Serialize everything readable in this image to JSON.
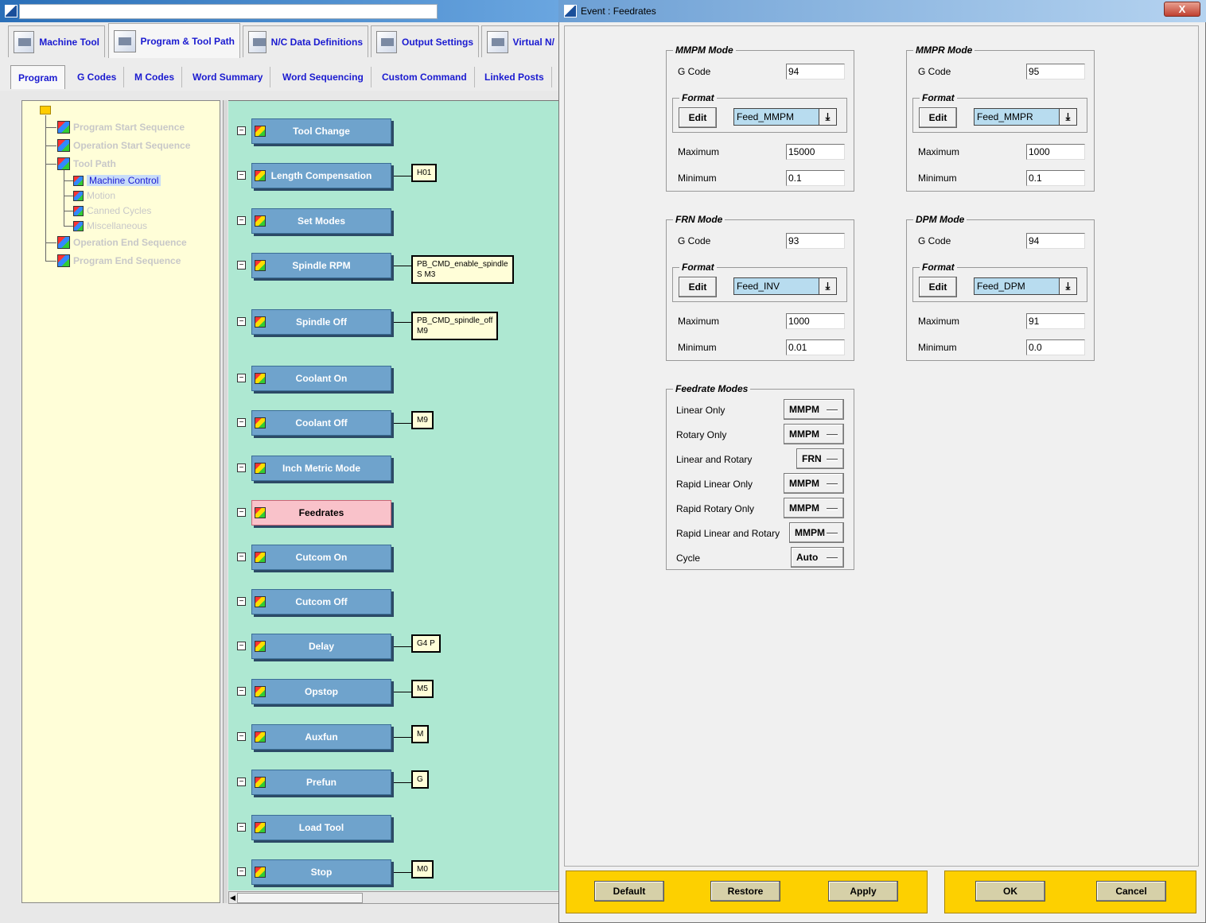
{
  "main": {
    "top_tabs": [
      {
        "label": "Machine Tool"
      },
      {
        "label": "Program & Tool Path"
      },
      {
        "label": "N/C Data Definitions"
      },
      {
        "label": "Output Settings"
      },
      {
        "label": "Virtual N/"
      }
    ],
    "sub_tabs": [
      {
        "label": "Program"
      },
      {
        "label": "G Codes"
      },
      {
        "label": "M Codes"
      },
      {
        "label": "Word Summary"
      },
      {
        "label": "Word Sequencing"
      },
      {
        "label": "Custom Command"
      },
      {
        "label": "Linked Posts"
      }
    ],
    "tree": [
      {
        "label": "Program Start Sequence"
      },
      {
        "label": "Operation Start Sequence"
      },
      {
        "label": "Tool Path"
      },
      {
        "label": "Machine Control"
      },
      {
        "label": "Motion"
      },
      {
        "label": "Canned Cycles"
      },
      {
        "label": "Miscellaneous"
      },
      {
        "label": "Operation End Sequence"
      },
      {
        "label": "Program End Sequence"
      }
    ],
    "events": [
      {
        "label": "Tool Change",
        "box": ""
      },
      {
        "label": "Length Compensation",
        "box": "H01"
      },
      {
        "label": "Set Modes",
        "box": ""
      },
      {
        "label": "Spindle RPM",
        "box": "PB_CMD_enable_spindle\nS M3"
      },
      {
        "label": "Spindle Off",
        "box": "PB_CMD_spindle_off\nM9"
      },
      {
        "label": "Coolant On",
        "box": ""
      },
      {
        "label": "Coolant Off",
        "box": "M9"
      },
      {
        "label": "Inch Metric Mode",
        "box": ""
      },
      {
        "label": "Feedrates",
        "box": ""
      },
      {
        "label": "Cutcom On",
        "box": ""
      },
      {
        "label": "Cutcom Off",
        "box": ""
      },
      {
        "label": "Delay",
        "box": "G4 P"
      },
      {
        "label": "Opstop",
        "box": "M5"
      },
      {
        "label": "Auxfun",
        "box": "M"
      },
      {
        "label": "Prefun",
        "box": "G"
      },
      {
        "label": "Load Tool",
        "box": ""
      },
      {
        "label": "Stop",
        "box": "M0"
      }
    ]
  },
  "dialog": {
    "title": "Event : Feedrates",
    "close": "X",
    "labels": {
      "gcode": "G Code",
      "format": "Format",
      "edit": "Edit",
      "maximum": "Maximum",
      "minimum": "Minimum"
    },
    "groups": {
      "mmpm": {
        "title": "MMPM Mode",
        "gcode": "94",
        "format": "Feed_MMPM",
        "max": "15000",
        "min": "0.1"
      },
      "mmpr": {
        "title": "MMPR Mode",
        "gcode": "95",
        "format": "Feed_MMPR",
        "max": "1000",
        "min": "0.1"
      },
      "frn": {
        "title": "FRN Mode",
        "gcode": "93",
        "format": "Feed_INV",
        "max": "1000",
        "min": "0.01"
      },
      "dpm": {
        "title": "DPM Mode",
        "gcode": "94",
        "format": "Feed_DPM",
        "max": "91",
        "min": "0.0"
      }
    },
    "feedrate_modes": {
      "title": "Feedrate Modes",
      "rows": [
        {
          "label": "Linear Only",
          "value": "MMPM"
        },
        {
          "label": "Rotary Only",
          "value": "MMPM"
        },
        {
          "label": "Linear and Rotary",
          "value": "FRN"
        },
        {
          "label": "Rapid Linear Only",
          "value": "MMPM"
        },
        {
          "label": "Rapid Rotary Only",
          "value": "MMPM"
        },
        {
          "label": "Rapid Linear and Rotary",
          "value": "MMPM"
        },
        {
          "label": "Cycle",
          "value": "Auto"
        }
      ]
    },
    "footer": {
      "default": "Default",
      "restore": "Restore",
      "apply": "Apply",
      "ok": "OK",
      "cancel": "Cancel"
    }
  }
}
